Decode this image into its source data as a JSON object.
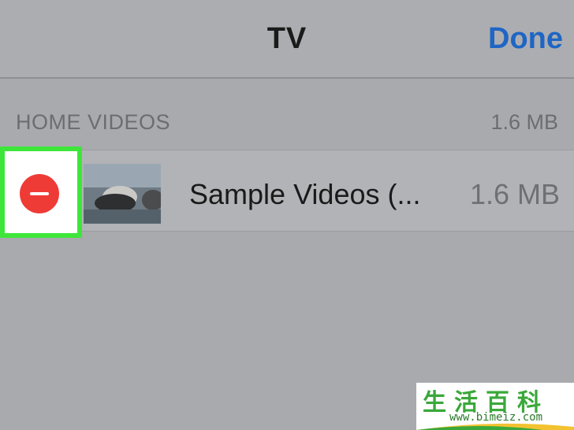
{
  "navbar": {
    "title": "TV",
    "done_label": "Done"
  },
  "section": {
    "title": "HOME VIDEOS",
    "size": "1.6 MB"
  },
  "items": [
    {
      "title": "Sample Videos (...",
      "size": "1.6 MB",
      "thumbnail": "video-thumbnail"
    }
  ],
  "watermark": {
    "chars": "生活百科",
    "url": "www.bimeiz.com"
  },
  "colors": {
    "accent": "#1f66c4",
    "delete": "#ef3b36",
    "highlight": "#3ee63a",
    "background": "#a9aaae"
  },
  "icons": {
    "delete": "minus-circle-icon"
  }
}
